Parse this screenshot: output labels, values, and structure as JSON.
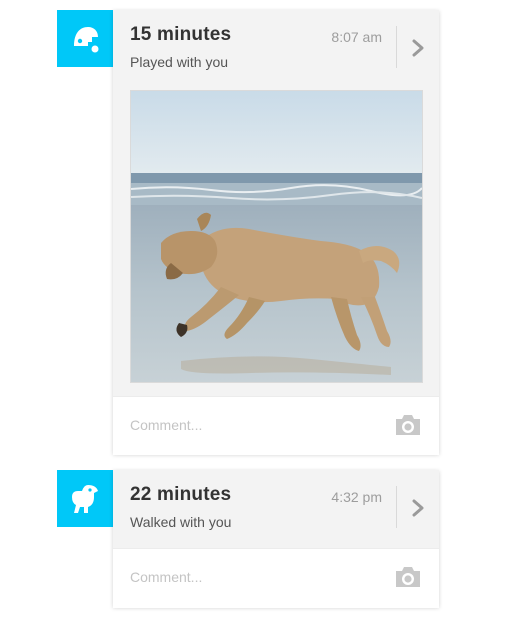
{
  "entries": [
    {
      "duration": "15 minutes",
      "activity": "Played with you",
      "time": "8:07 am",
      "comment_placeholder": "Comment..."
    },
    {
      "duration": "22 minutes",
      "activity": "Walked with you",
      "time": "4:32 pm",
      "comment_placeholder": "Comment..."
    }
  ],
  "colors": {
    "accent": "#00c8f8",
    "card_bg": "#f3f3f3",
    "muted": "#9d9d9d"
  },
  "icons": [
    "ball-play-icon",
    "dog-walk-icon",
    "chevron-right-icon",
    "camera-icon"
  ]
}
